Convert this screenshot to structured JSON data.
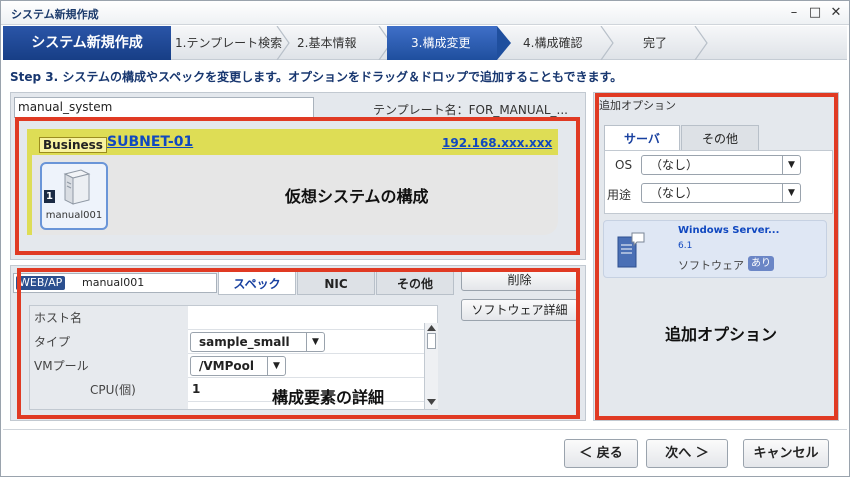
{
  "window": {
    "title": "システム新規作成",
    "controls": [
      "–",
      "□",
      "✕"
    ]
  },
  "steps": [
    {
      "label": "システム新規作成"
    },
    {
      "label": "1.テンプレート検索"
    },
    {
      "label": "2.基本情報"
    },
    {
      "label": "3.構成変更"
    },
    {
      "label": "4.構成確認"
    },
    {
      "label": "完了"
    }
  ],
  "instruction": "Step 3. システムの構成やスペックを変更します。オプションをドラッグ＆ドロップで追加することもできます。",
  "system": {
    "name_value": "manual_system",
    "template_label": "テンプレート名：FOR_MANUAL_...",
    "subnet_badge": "Business",
    "subnet_name": "SUBNET-01",
    "subnet_ip": "192.168.xxx.xxx",
    "server_number": "1",
    "server_name": "manual001",
    "annotation": "仮想システムの構成"
  },
  "detail": {
    "role_badge": "WEB/AP",
    "server_name": "manual001",
    "tabs": [
      "スペック",
      "NIC",
      "その他"
    ],
    "delete_button": "削除",
    "software_detail_button": "ソフトウェア詳細",
    "rows": [
      {
        "key": "ホスト名",
        "value": ""
      },
      {
        "key": "タイプ",
        "value": "sample_small"
      },
      {
        "key": "VMプール",
        "value": "/VMPool"
      },
      {
        "key": "CPU(個)",
        "value": "1"
      }
    ],
    "annotation": "構成要素の詳細"
  },
  "options": {
    "title": "追加オプション",
    "tabs": [
      "サーバ",
      "その他"
    ],
    "os_label": "OS",
    "os_value": "（なし）",
    "use_label": "用途",
    "use_value": "（なし）",
    "software_name": "Windows Server...",
    "software_version": "6.1",
    "software_type": "ソフトウェア",
    "software_badge": "あり",
    "annotation": "追加オプション"
  },
  "footer": {
    "back_button": "＜ 戻る",
    "next_button": "次へ ＞",
    "cancel_button": "キャンセル"
  },
  "colors": {
    "step_active": "#1f4f9e",
    "annotation_box": "#e03a23",
    "subnet_band": "#dedd55",
    "link": "#1048c0"
  },
  "icons": [
    "server-icon",
    "software-icon"
  ]
}
